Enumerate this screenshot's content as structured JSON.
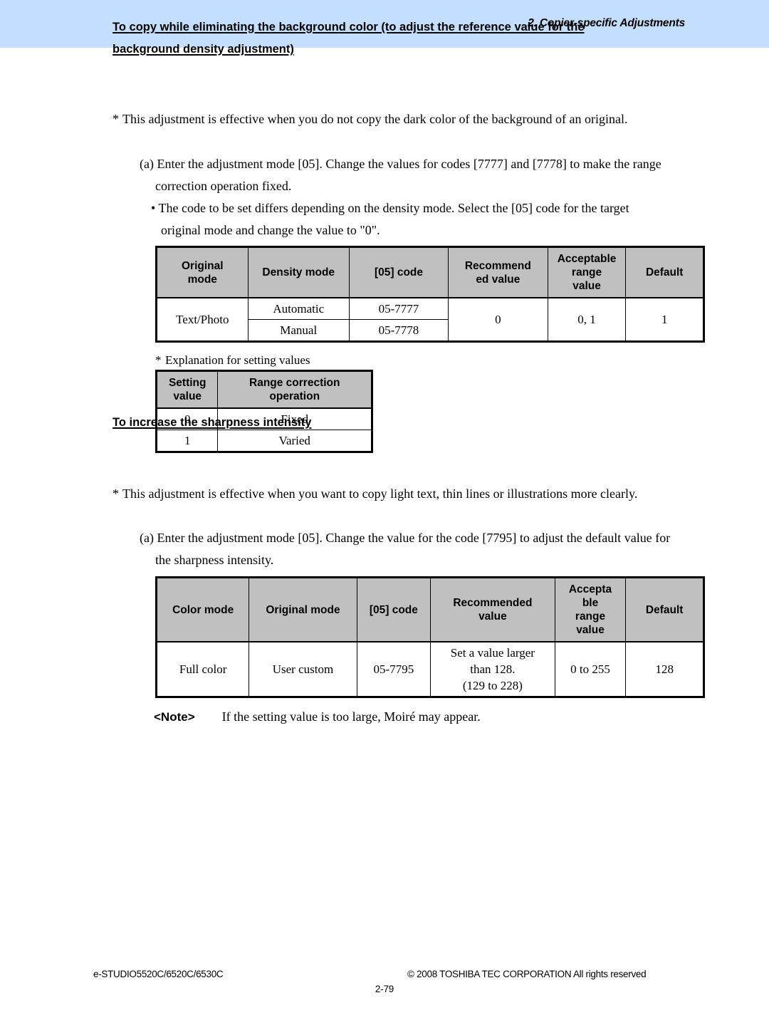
{
  "header": {
    "title": "2. Copier-specific Adjustments",
    "band_color": "#c3dffd"
  },
  "sections": [
    {
      "heading_line1": "To copy while eliminating the background color (to adjust the reference value for the",
      "heading_line2": "background density adjustment)",
      "note_star": "This adjustment is effective when you do not copy the dark color of the background of an original.",
      "step_a_line1": "(a) Enter the adjustment mode [05]. Change the values for codes [7777] and [7778] to make the range",
      "step_a_line2": "correction operation fixed.",
      "bullet_line1": "• The code to be set differs depending on the density mode. Select the [05] code for the target",
      "bullet_line2": "original mode and change the value to \"0\"."
    },
    {
      "heading": "To increase the sharpness intensity",
      "note_star": "This adjustment is effective when you want to copy light text, thin lines or illustrations more clearly.",
      "step_a_line1": "(a) Enter the adjustment mode [05]. Change the value for the code [7795] to adjust the default value for",
      "step_a_line2": "the sharpness intensity."
    }
  ],
  "table_background": {
    "headers": [
      "Original mode",
      "Density mode",
      "[05] code",
      "Recommend ed value",
      "Acceptable range value",
      "Default"
    ],
    "header_lines": [
      [
        "Original",
        "mode"
      ],
      [
        "Density mode"
      ],
      [
        "[05] code"
      ],
      [
        "Recommend",
        "ed value"
      ],
      [
        "Acceptable",
        "range",
        "value"
      ],
      [
        "Default"
      ]
    ],
    "rows": [
      {
        "original_mode": "Text/Photo",
        "density_mode": "Automatic",
        "code": "05-7777",
        "recommended": "0",
        "acceptable_range": "0, 1",
        "default": "1"
      },
      {
        "density_mode": "Manual",
        "code": "05-7778"
      }
    ]
  },
  "explanation_caption": "Explanation for setting values",
  "table_setting_values": {
    "header_lines": [
      [
        "Setting",
        "value"
      ],
      [
        "Range correction",
        "operation"
      ]
    ],
    "rows": [
      {
        "setting_value": "0",
        "operation": "Fixed"
      },
      {
        "setting_value": "1",
        "operation": "Varied"
      }
    ]
  },
  "table_sharpness": {
    "header_lines": [
      [
        "Color mode"
      ],
      [
        "Original mode"
      ],
      [
        "[05] code"
      ],
      [
        "Recommended",
        "value"
      ],
      [
        "Accepta",
        "ble",
        "range",
        "value"
      ],
      [
        "Default"
      ]
    ],
    "rows": [
      {
        "color_mode": "Full color",
        "original_mode": "User custom",
        "code": "05-7795",
        "recommended_line1": "Set a value larger",
        "recommended_line2": "than 128.",
        "recommended_line3": "(129 to 228)",
        "acceptable_range": "0 to 255",
        "default": "128"
      }
    ]
  },
  "note": {
    "label": "<Note>",
    "text": "If the setting value is too large, Moiré may appear."
  },
  "footer": {
    "model": "e-STUDIO5520C/6520C/6530C",
    "copyright": "© 2008 TOSHIBA TEC CORPORATION All rights reserved",
    "page": "2-79"
  }
}
